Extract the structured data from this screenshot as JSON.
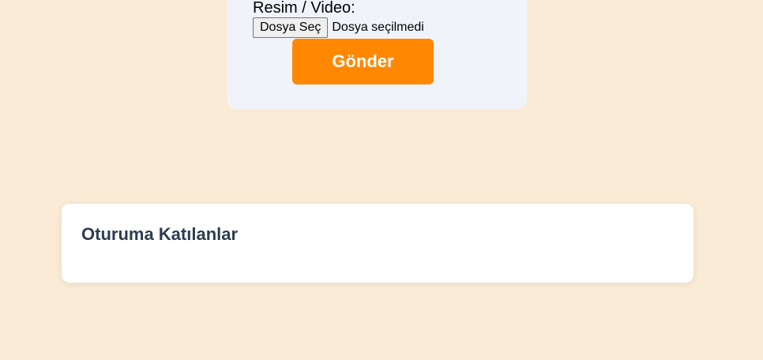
{
  "upload_form": {
    "media_label": "Resim / Video:",
    "file_button_label": "Dosya Seç",
    "file_status": "Dosya seçilmedi",
    "submit_label": "Gönder"
  },
  "participants": {
    "title": "Oturuma Katılanlar",
    "items": []
  },
  "colors": {
    "page_background": "#faebd7",
    "form_background": "#f0f4fa",
    "submit_background": "#ff8800",
    "title_text": "#2c3e50"
  }
}
